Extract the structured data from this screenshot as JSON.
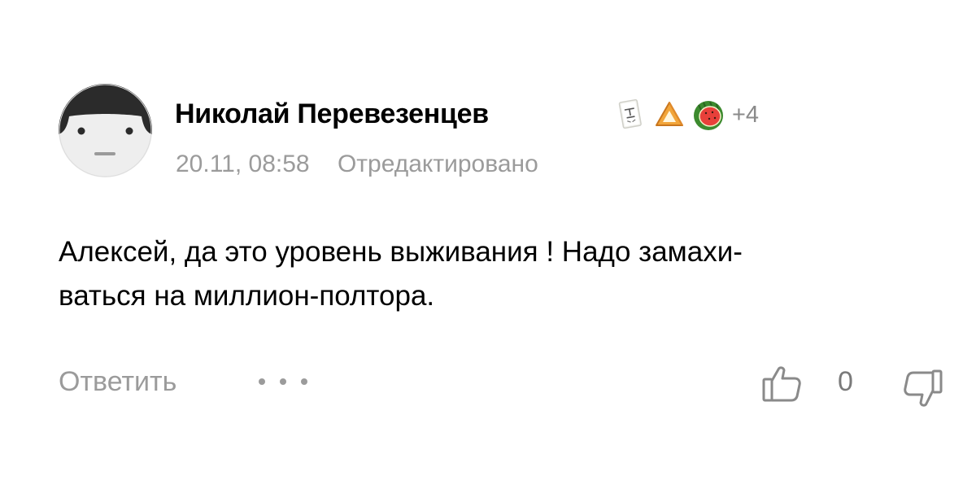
{
  "comment": {
    "author": {
      "name": "Николай Перевезенцев",
      "avatar_icon": "default-face-avatar"
    },
    "badges": [
      {
        "icon": "book-badge-icon"
      },
      {
        "icon": "triangle-pastry-badge-icon"
      },
      {
        "icon": "watermelon-badge-icon"
      }
    ],
    "badges_more": "+4",
    "meta": {
      "datetime": "20.11, 08:58",
      "edited_label": "Отредактировано"
    },
    "text_lines": [
      "Алексей, да это уровень выживания ! Надо замахи-",
      "ваться на миллион-полтора."
    ],
    "actions": {
      "reply_label": "Ответить",
      "more_icon": "more-dots-icon",
      "like_icon": "thumbs-up-icon",
      "like_count": "0",
      "dislike_icon": "thumbs-down-icon"
    },
    "colors": {
      "text": "#000000",
      "secondary": "#9b9b9b",
      "background": "#ffffff"
    }
  }
}
